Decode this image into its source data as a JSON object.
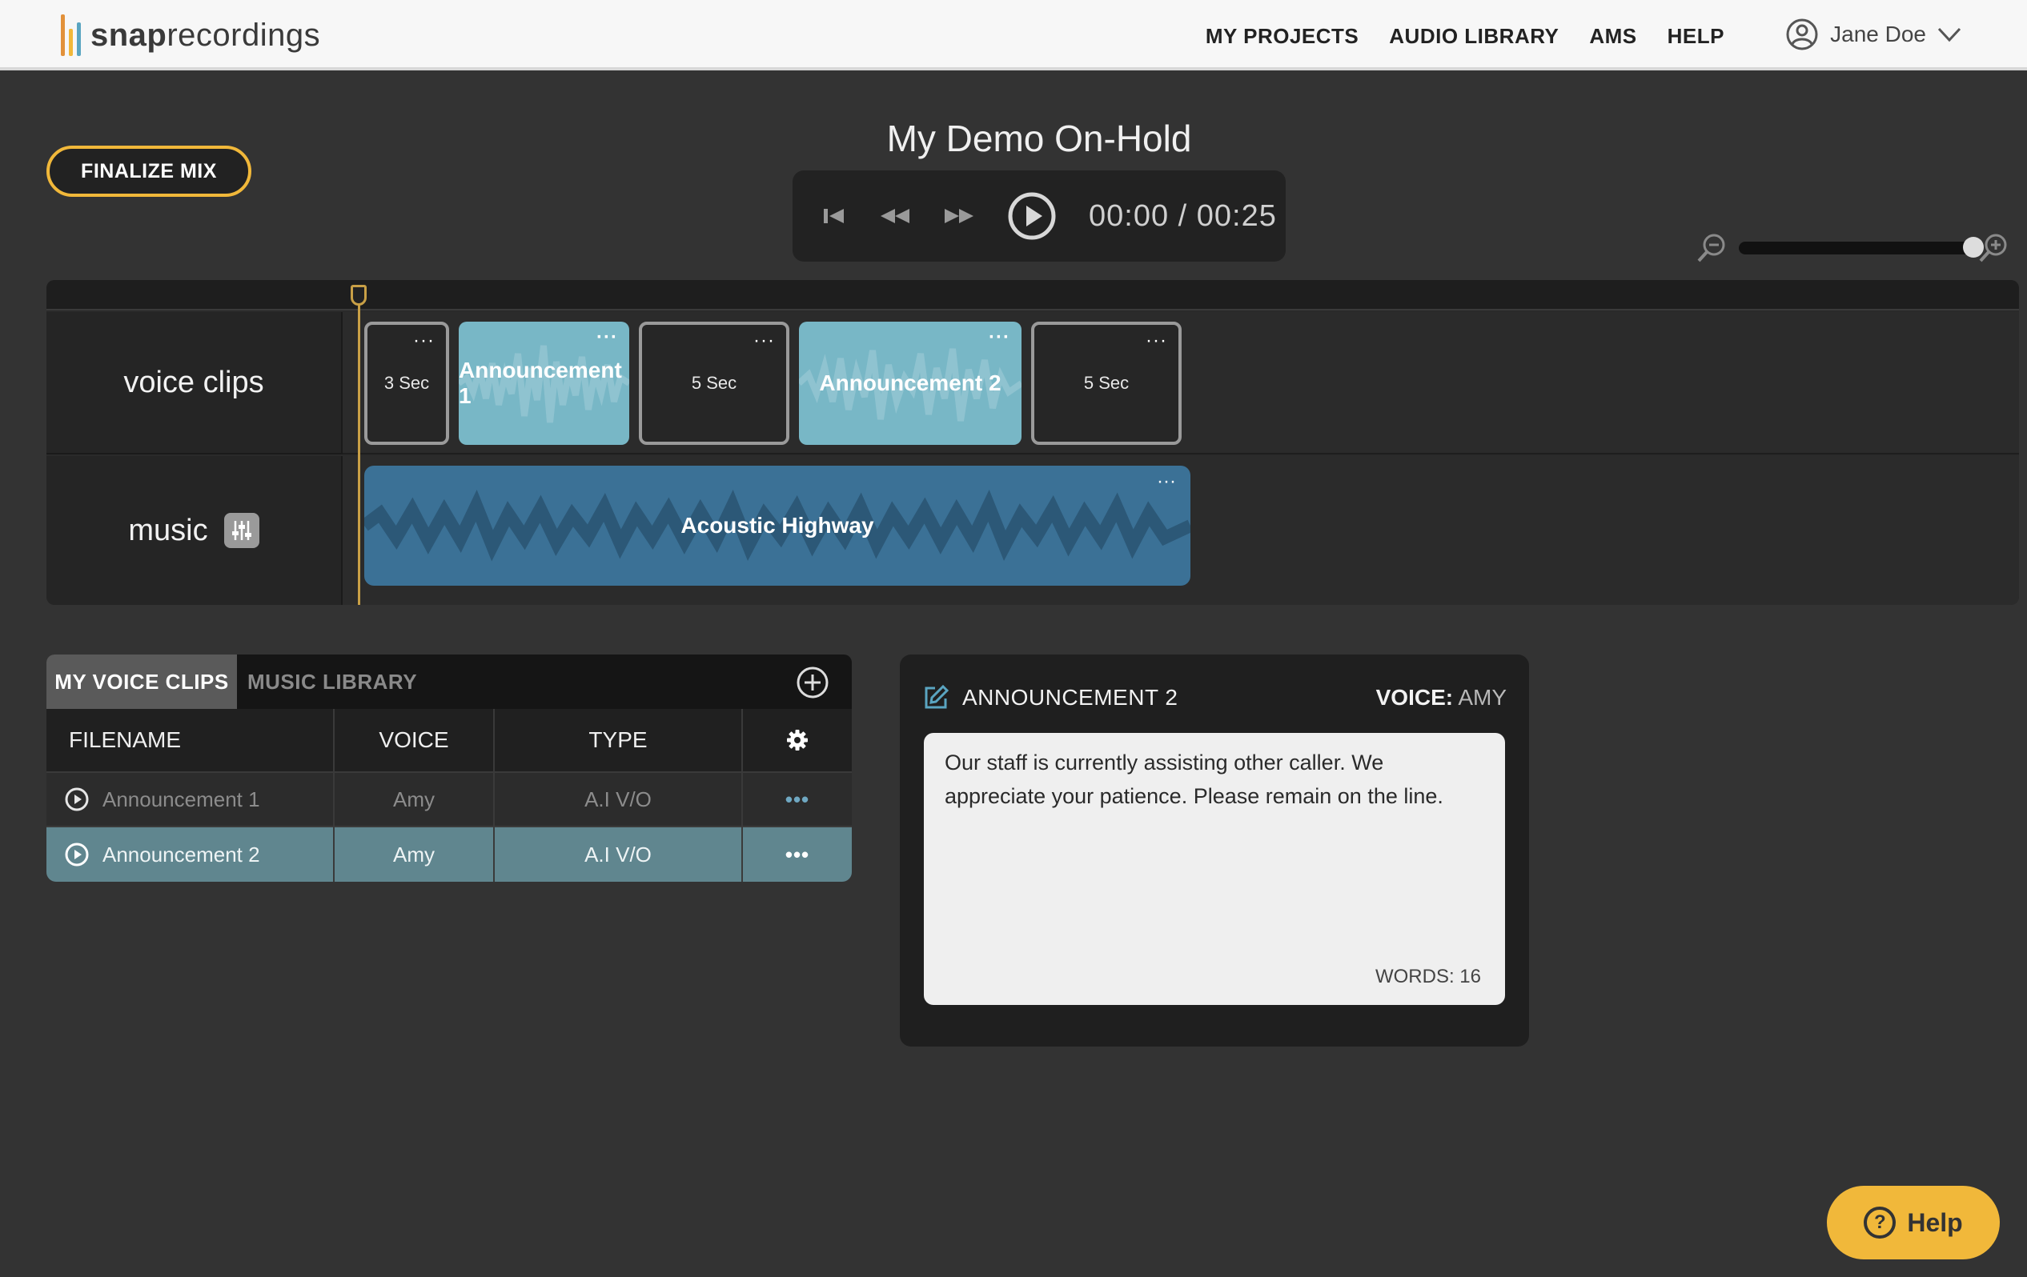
{
  "app": {
    "logo_prefix": "snap",
    "logo_suffix": "recordings",
    "logo_bar_colors": [
      "#e2913a",
      "#f1b83a",
      "#5aa5c1"
    ]
  },
  "nav": {
    "items": [
      "MY PROJECTS",
      "AUDIO LIBRARY",
      "AMS",
      "HELP"
    ]
  },
  "user": {
    "name": "Jane Doe",
    "icon": "user-circle-icon"
  },
  "project": {
    "title": "My Demo On-Hold",
    "finalize_label": "FINALIZE MIX"
  },
  "transport": {
    "time": "00:00 / 00:25"
  },
  "zoom": {
    "level": 0.95
  },
  "timeline": {
    "tracks": {
      "voice_label": "voice clips",
      "music_label": "music"
    },
    "voice_clips": [
      {
        "kind": "silence",
        "label": "3 Sec"
      },
      {
        "kind": "voice",
        "label": "Announcement 1"
      },
      {
        "kind": "silence",
        "label": "5 Sec"
      },
      {
        "kind": "voice",
        "label": "Announcement 2"
      },
      {
        "kind": "silence",
        "label": "5 Sec"
      }
    ],
    "music_clip": {
      "label": "Acoustic Highway"
    },
    "more": "···"
  },
  "clips_panel": {
    "tabs": [
      "MY VOICE CLIPS",
      "MUSIC LIBRARY"
    ],
    "columns": [
      "FILENAME",
      "VOICE",
      "TYPE"
    ],
    "rows": [
      {
        "filename": "Announcement 1",
        "voice": "Amy",
        "type": "A.I V/O"
      },
      {
        "filename": "Announcement 2",
        "voice": "Amy",
        "type": "A.I V/O"
      }
    ],
    "row_more": "•••"
  },
  "editor": {
    "title": "ANNOUNCEMENT 2",
    "voice_label": "VOICE:",
    "voice_value": "AMY",
    "text": "Our staff is currently assisting other caller. We appreciate your patience.  Please remain on the line.",
    "word_count": "WORDS: 16"
  },
  "help": {
    "label": "Help",
    "glyph": "?"
  },
  "colors": {
    "accent": "#f1b83a",
    "voice_clip": "#78b7c6",
    "music_clip": "#3b7196",
    "selected_row": "#60868f"
  }
}
